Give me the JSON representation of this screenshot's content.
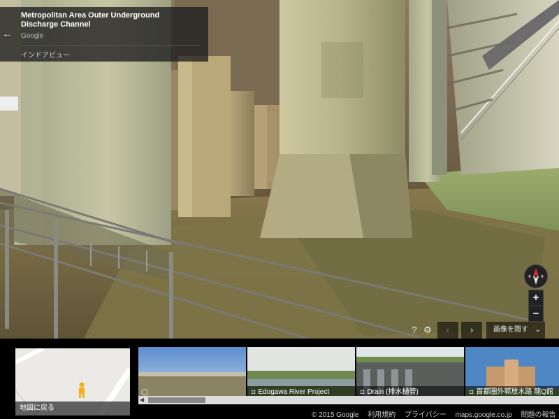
{
  "place": {
    "title": "Metropolitan Area Outer Underground Discharge Channel",
    "owner": "Google",
    "type": "インドアビュー"
  },
  "icons": {
    "back": "back-arrow-icon",
    "compass": "compass-icon",
    "help": "help-icon",
    "settings": "gear-icon",
    "camera": "camera-icon",
    "pegman": "pegman-icon"
  },
  "controls": {
    "zoom_in": "+",
    "zoom_out": "−",
    "help": "?",
    "settings": "⚙",
    "prev": "‹",
    "next": "›",
    "hide_images": "画像を隠す",
    "hide_chevron": "⌄"
  },
  "filmstrip": {
    "back_to_map": "地図に戻る",
    "thumbnails": [
      {
        "caption": ""
      },
      {
        "caption": "Edogawa River Project"
      },
      {
        "caption": "Drain (排水樋管)"
      },
      {
        "caption": "首都圏外郭放水路 龍Q館"
      }
    ]
  },
  "footer": {
    "copyright": "© 2015 Google",
    "terms": "利用規約",
    "privacy": "プライバシー",
    "site": "maps.google.co.jp",
    "report": "問題の報告"
  },
  "colors": {
    "panel": "#1e1e1e",
    "compass_north": "#d62f2f"
  }
}
